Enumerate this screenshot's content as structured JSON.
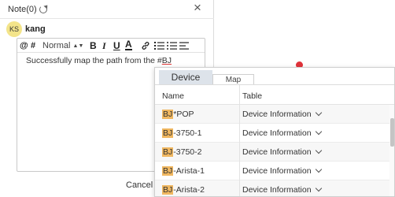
{
  "note": {
    "title": "Note(0)",
    "close_glyph": "×",
    "user": {
      "initials": "KS",
      "name": "kang"
    },
    "toolbar": {
      "at": "@",
      "hash": "#",
      "font_size": "Normal",
      "bold": "B",
      "italic": "I",
      "underline": "U",
      "color": "A"
    },
    "text_prefix": "Successfully map the path from the #",
    "text_mention": "BJ",
    "cancel_label": "Cancel"
  },
  "mention_popup": {
    "tabs": [
      {
        "label": "Device",
        "active": true
      },
      {
        "label": "Map",
        "active": false
      }
    ],
    "columns": {
      "name": "Name",
      "table": "Table"
    },
    "rows": [
      {
        "match": "BJ",
        "rest": "*POP",
        "table": "Device Information"
      },
      {
        "match": "BJ",
        "rest": "-3750-1",
        "table": "Device Information"
      },
      {
        "match": "BJ",
        "rest": "-3750-2",
        "table": "Device Information"
      },
      {
        "match": "BJ",
        "rest": "-Arista-1",
        "table": "Device Information"
      },
      {
        "match": "BJ",
        "rest": "-Arista-2",
        "table": "Device Information"
      }
    ]
  },
  "colors": {
    "avatar_bg": "#f3e48a",
    "highlight": "#f0b760",
    "active_tab": "#dde3ea",
    "badge": "#e0323a"
  },
  "icons": [
    "refresh-icon",
    "close-icon",
    "link-icon",
    "ordered-list-icon",
    "bullet-list-icon",
    "align-left-icon",
    "chevron-down-icon"
  ]
}
